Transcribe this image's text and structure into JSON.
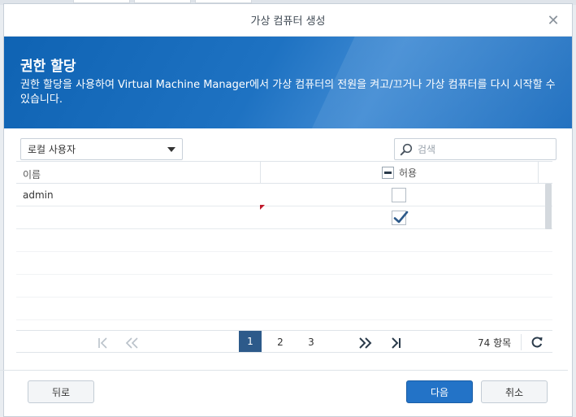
{
  "dialog": {
    "title": "가상 컴퓨터 생성",
    "close_label": "✕"
  },
  "banner": {
    "heading": "권한 할당",
    "description": "권한 할당을 사용하여 Virtual Machine Manager에서 가상 컴퓨터의 전원을 켜고/끄거나 가상 컴퓨터를 다시 시작할 수 있습니다."
  },
  "toolbar": {
    "user_type_selected": "로컬 사용자",
    "search_placeholder": "검색"
  },
  "grid": {
    "columns": {
      "name": "이름",
      "allow": "허용"
    },
    "rows": [
      {
        "name": "admin",
        "allowed": false
      },
      {
        "name": "",
        "allowed": true
      }
    ]
  },
  "pager": {
    "first": "|‹",
    "prev": "‹‹",
    "pages": [
      "1",
      "2",
      "3"
    ],
    "current_page": "1",
    "next": "››",
    "last": "›|",
    "count_label": "74 항목"
  },
  "footer": {
    "back_label": "뒤로",
    "next_label": "다음",
    "cancel_label": "취소"
  },
  "colors": {
    "primary": "#2373c7",
    "banner": "#1e72c2",
    "pager_active": "#2d5a8a",
    "check": "#2d5a8a"
  }
}
